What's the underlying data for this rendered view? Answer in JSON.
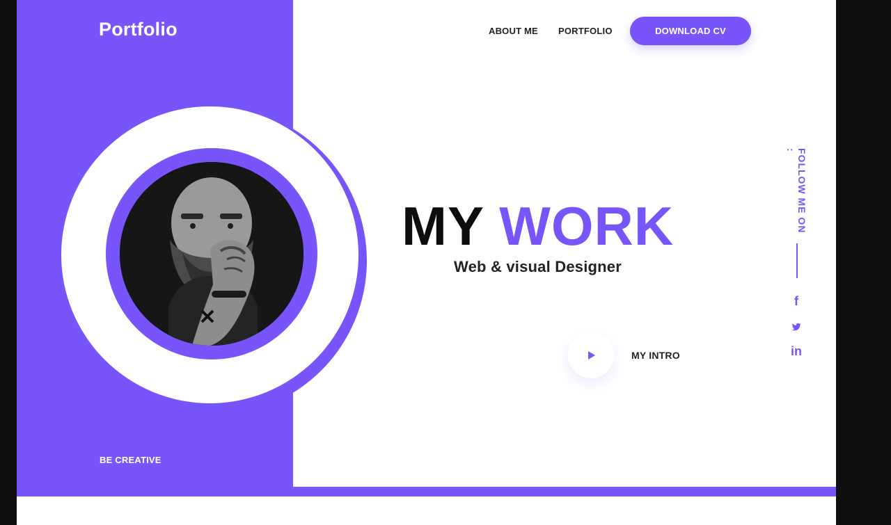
{
  "brand": "Portfolio",
  "tagline": "BE CREATIVE",
  "nav": {
    "items": [
      {
        "label": "ABOUT ME"
      },
      {
        "label": "PORTFOLIO"
      }
    ],
    "cta": "DOWNLOAD CV"
  },
  "hero": {
    "headline_primary": "MY",
    "headline_accent": "WORK",
    "subtitle": "Web & visual Designer",
    "intro_label": "MY INTRO"
  },
  "social": {
    "label": "FOLLOW ME ON :",
    "icons": [
      "facebook-icon",
      "twitter-icon",
      "linkedin-icon"
    ]
  },
  "colors": {
    "accent": "#7755fb",
    "background": "#ffffff",
    "text": "#222222"
  }
}
